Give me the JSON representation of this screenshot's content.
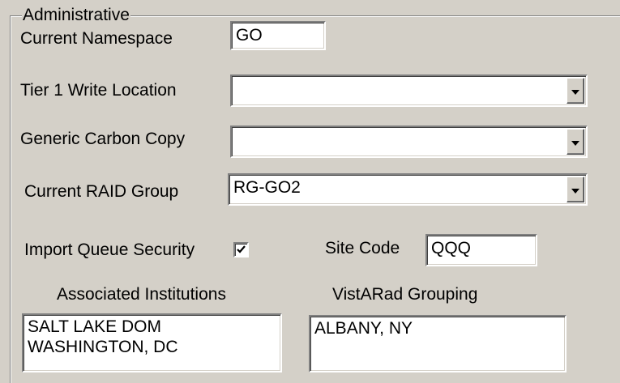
{
  "group": {
    "title": "Administrative"
  },
  "fields": {
    "current_namespace": {
      "label": "Current Namespace",
      "value": "GO"
    },
    "tier1_write_location": {
      "label": "Tier 1 Write Location",
      "value": ""
    },
    "generic_carbon_copy": {
      "label": "Generic Carbon Copy",
      "value": ""
    },
    "current_raid_group": {
      "label": "Current RAID Group",
      "value": "RG-GO2"
    },
    "import_queue_security": {
      "label": "Import Queue Security",
      "checked": true
    },
    "site_code": {
      "label": "Site Code",
      "value": "QQQ"
    },
    "associated_institutions": {
      "label": "Associated Institutions",
      "items": [
        "SALT LAKE DOM",
        "WASHINGTON, DC"
      ]
    },
    "vistarad_grouping": {
      "label": "VistARad Grouping",
      "items": [
        "ALBANY, NY"
      ]
    }
  },
  "icons": {
    "dropdown": "chevron-down-icon",
    "checkmark": "checkmark-icon"
  },
  "colors": {
    "window_bg": "#d4d0c8",
    "field_bg": "#ffffff",
    "shadow": "#808080",
    "highlight": "#ffffff"
  }
}
